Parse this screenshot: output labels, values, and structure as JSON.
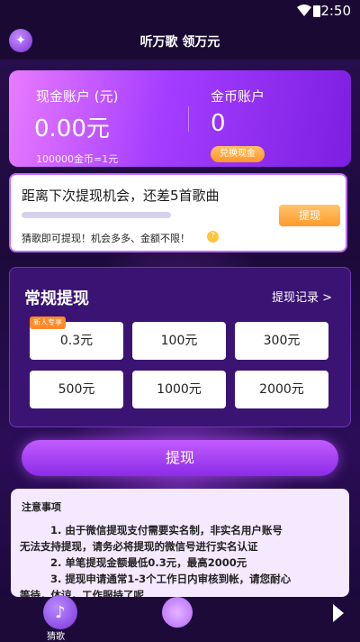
{
  "status": {
    "time": "2:50",
    "wifi_icon": "wifi-icon",
    "battery_icon": "battery-icon"
  },
  "topbar": {
    "title": "听万歌 领万元",
    "logo_icon": "star-logo-icon"
  },
  "account": {
    "cash_label": "现金账户 (元)",
    "cash_value": "0.00元",
    "rate_text": "100000金币=1元",
    "coin_label": "金币账户",
    "coin_value": "0",
    "exchange_button": "兑换现金"
  },
  "progress": {
    "message": "距离下次提现机会，还差5首歌曲",
    "fraction": 0,
    "button": "提现",
    "tip": "猜歌即可提现！机会多多、金额不限！",
    "help_icon": "question-icon",
    "help_text": "?"
  },
  "regular": {
    "title": "常规提现",
    "record_link": "提现记录 >",
    "amounts": [
      {
        "label": "0.3元",
        "badge": "新人专享"
      },
      {
        "label": "100元",
        "badge": ""
      },
      {
        "label": "300元",
        "badge": ""
      },
      {
        "label": "500元",
        "badge": ""
      },
      {
        "label": "1000元",
        "badge": ""
      },
      {
        "label": "2000元",
        "badge": ""
      }
    ]
  },
  "withdraw_button": "提现",
  "notes": {
    "title": "注意事项",
    "lines": [
      "1. 由于微信提现支付需要实名制，非实名用户账号",
      "无法支持提现，请务必将提现的微信号进行实名认证",
      "2. 单笔提现金额最低0.3元，最高2000元",
      "3. 提现申请通常1-3个工作日内审核到帐，请您耐心",
      "等待，体谅，工作服持了呢"
    ]
  },
  "bottom": {
    "music_label": "猜歌",
    "music_icon": "music-note-icon"
  },
  "colors": {
    "accent": "#a43dff",
    "orange": "#ff9a2a",
    "background": "#1e0b3a"
  }
}
